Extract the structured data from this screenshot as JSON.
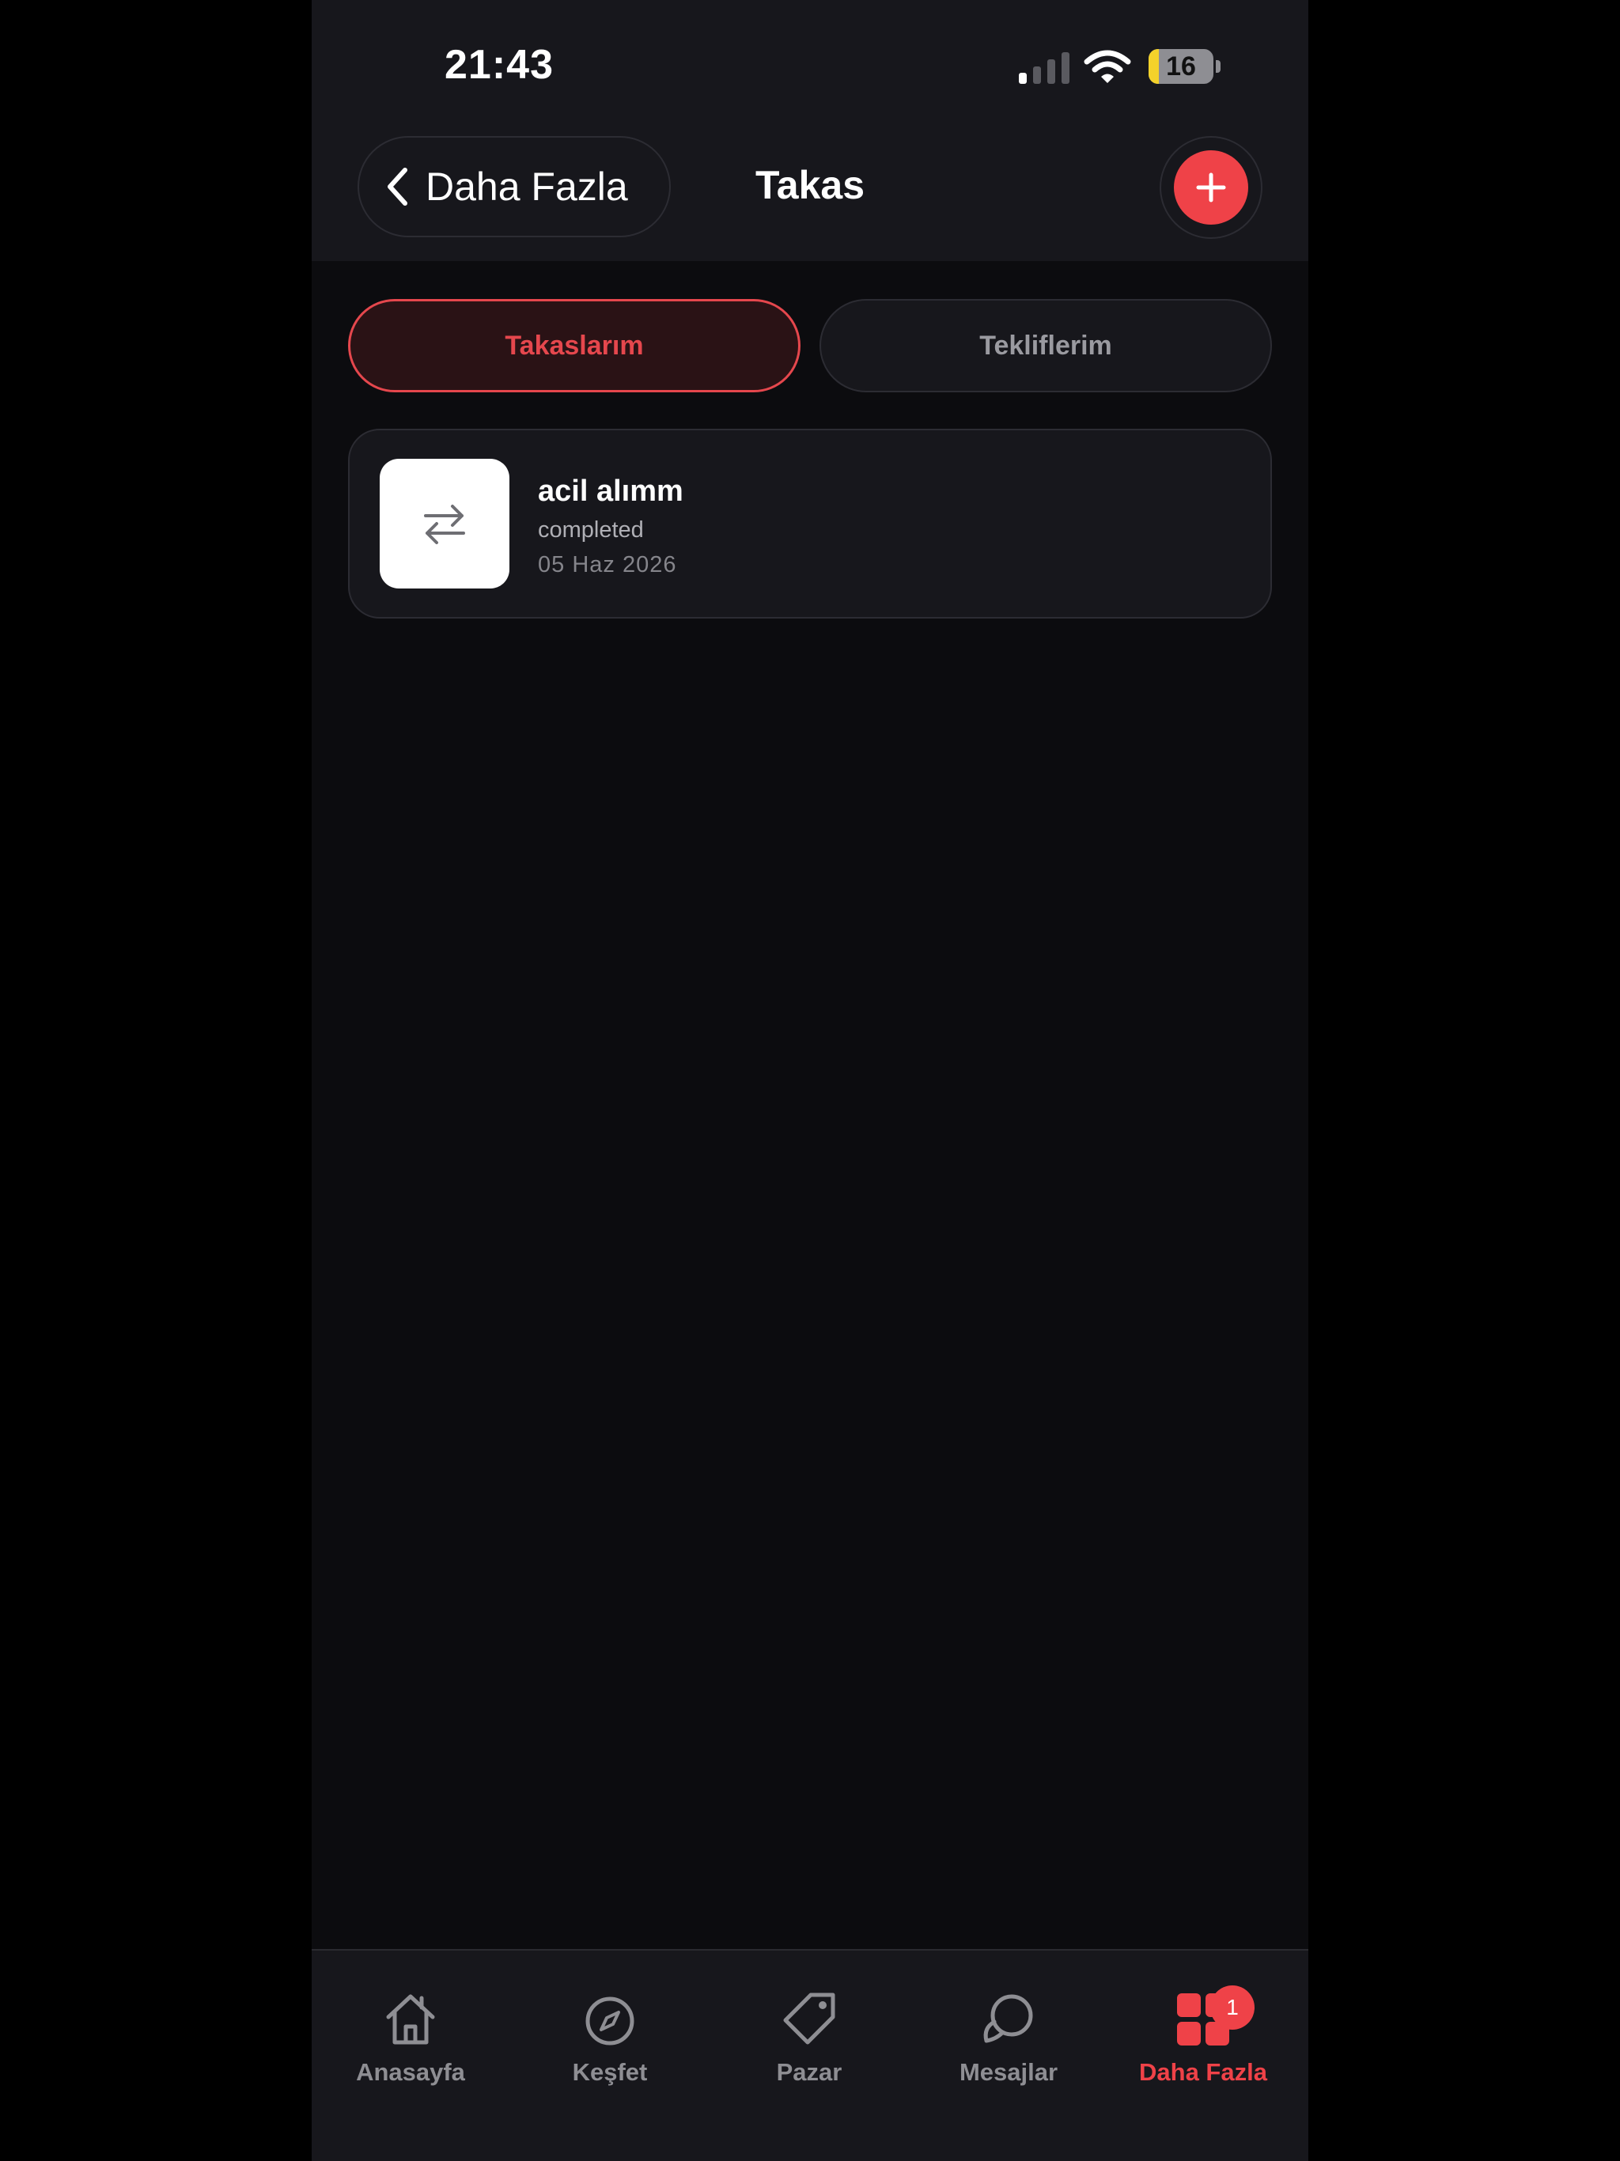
{
  "status_bar": {
    "time": "21:43",
    "battery_level": "16",
    "signal_bars_active": 1,
    "signal_bars_total": 4
  },
  "header": {
    "back_label": "Daha Fazla",
    "title": "Takas",
    "add_icon": "plus-icon"
  },
  "tabs": [
    {
      "label": "Takaslarım",
      "active": true
    },
    {
      "label": "Tekliflerim",
      "active": false
    }
  ],
  "trades": [
    {
      "title": "acil alımm",
      "status": "completed",
      "date": "05 Haz 2026",
      "icon": "swap-arrows-icon"
    }
  ],
  "tab_bar": {
    "items": [
      {
        "label": "Anasayfa",
        "icon": "home-icon"
      },
      {
        "label": "Keşfet",
        "icon": "compass-icon"
      },
      {
        "label": "Pazar",
        "icon": "tag-icon"
      },
      {
        "label": "Mesajlar",
        "icon": "chat-bubbles-icon"
      },
      {
        "label": "Daha Fazla",
        "icon": "grid-icon",
        "active": true,
        "badge": "1"
      }
    ]
  },
  "colors": {
    "accent": "#ef4248",
    "background": "#0c0c0f",
    "surface": "#17171c",
    "active_tab_bg": "#2a1215",
    "muted_text": "#8e8e93",
    "battery_low": "#f4d22a"
  }
}
